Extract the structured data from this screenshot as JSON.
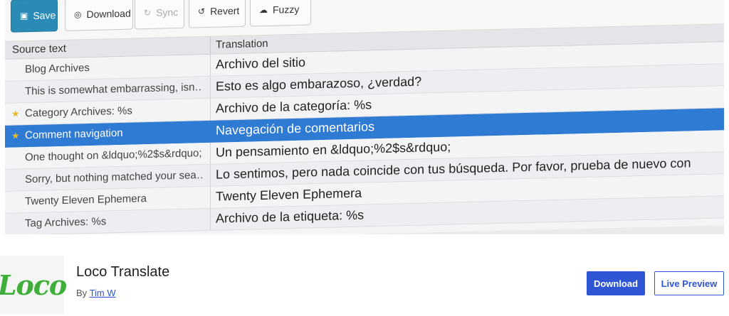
{
  "toolbar": {
    "save": "Save",
    "download": "Download",
    "sync": "Sync",
    "revert": "Revert",
    "fuzzy": "Fuzzy"
  },
  "table": {
    "source_header": "Source text",
    "translation_header": "Translation",
    "rows": [
      {
        "source": "Blog Archives",
        "translation": "Archivo del sitio"
      },
      {
        "source": "This is somewhat embarrassing, isn…",
        "translation": "Esto es algo embarazoso, ¿verdad?"
      },
      {
        "source": "Category Archives: %s",
        "translation": "Archivo de la categoría: %s"
      },
      {
        "source": "Comment navigation",
        "translation": "Navegación de comentarios"
      },
      {
        "source": "One thought on &ldquo;%2$s&rdquo;",
        "translation": "Un pensamiento en &ldquo;%2$s&rdquo;"
      },
      {
        "source": "Sorry, but nothing matched your sea…",
        "translation": "Lo sentimos, pero nada coincide con tus búsqueda. Por favor, prueba de nuevo con"
      },
      {
        "source": "Twenty Eleven Ephemera",
        "translation": "Twenty Eleven Ephemera"
      },
      {
        "source": "Tag Archives: %s",
        "translation": "Archivo de la etiqueta: %s"
      }
    ]
  },
  "plugin": {
    "logo_text": "Loco",
    "name": "Loco Translate",
    "by_label": "By",
    "author": "Tim W",
    "download_label": "Download",
    "preview_label": "Live Preview"
  },
  "colors": {
    "accent": "#2f55d4",
    "selected_row": "#2f7bd4",
    "save_button": "#2a8bb6",
    "logo_green": "#3fae3a",
    "star": "#e7b824"
  },
  "icons": {
    "save": "floppy-icon",
    "download": "circle-icon",
    "sync": "sync-icon",
    "revert": "revert-icon",
    "fuzzy": "cloud-icon",
    "star": "star-icon"
  }
}
